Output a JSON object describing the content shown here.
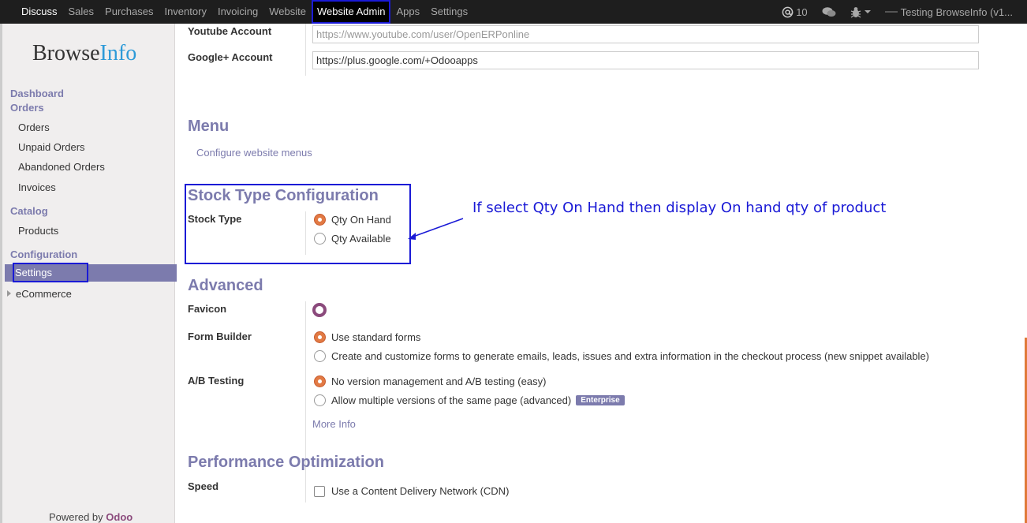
{
  "topbar": {
    "menu": [
      "Discuss",
      "Sales",
      "Purchases",
      "Inventory",
      "Invoicing",
      "Website",
      "Website Admin",
      "Apps",
      "Settings"
    ],
    "active": "Website Admin",
    "messages_count": "10",
    "user": "Testing BrowseInfo (v1..."
  },
  "sidebar": {
    "logo_browse": "Browse",
    "logo_info": "Info",
    "dashboard": "Dashboard",
    "orders_head": "Orders",
    "orders_items": [
      "Orders",
      "Unpaid Orders",
      "Abandoned Orders",
      "Invoices"
    ],
    "catalog_head": "Catalog",
    "catalog_items": [
      "Products"
    ],
    "config_head": "Configuration",
    "settings": "Settings",
    "ecommerce": "eCommerce",
    "powered_by": "Powered by",
    "odoo": "Odoo"
  },
  "social": {
    "youtube_label": "Youtube Account",
    "youtube_placeholder": "https://www.youtube.com/user/OpenERPonline",
    "google_label": "Google+ Account",
    "google_value": "https://plus.google.com/+Odooapps"
  },
  "menu_section": {
    "title": "Menu",
    "configure_link": "Configure website menus"
  },
  "stock": {
    "title": "Stock Type Configuration",
    "label": "Stock Type",
    "options": [
      "Qty On Hand",
      "Qty Available"
    ],
    "selected": "Qty On Hand",
    "annotation": "If select Qty On Hand then display On hand qty of product"
  },
  "advanced": {
    "title": "Advanced",
    "favicon_label": "Favicon",
    "form_builder_label": "Form Builder",
    "form_options": [
      "Use standard forms",
      "Create and customize forms to generate emails, leads, issues and extra information in the checkout process (new snippet available)"
    ],
    "ab_label": "A/B Testing",
    "ab_options": [
      "No version management and A/B testing (easy)",
      "Allow multiple versions of the same page (advanced)"
    ],
    "enterprise_badge": "Enterprise",
    "more_info": "More Info"
  },
  "performance": {
    "title": "Performance Optimization",
    "speed_label": "Speed",
    "cdn_label": "Use a Content Delivery Network (CDN)"
  },
  "colors": {
    "accent": "#7c7bad",
    "annotation": "#1a1ad6",
    "radio_on": "#e27a44"
  }
}
